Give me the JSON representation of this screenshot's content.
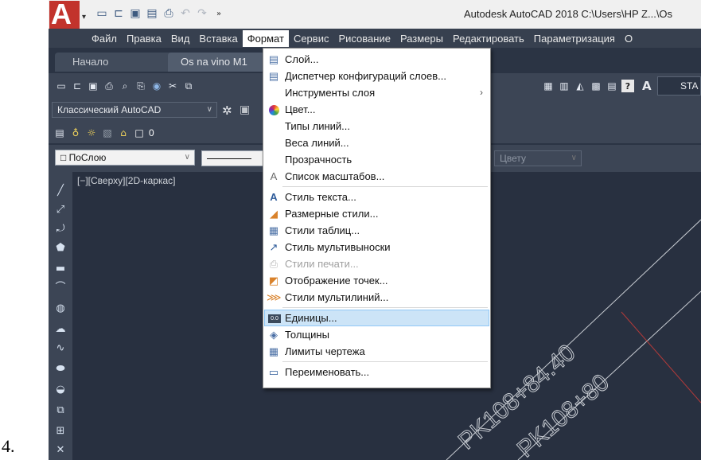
{
  "outer_label": "4.",
  "colors": {
    "app_background": "#2b3444",
    "menubar": "#37404f",
    "highlight": "#cce4f7",
    "logo_red": "#c2332c",
    "canvas_line_red": "#b03a3a"
  },
  "titlebar": {
    "logo_letter": "A",
    "app_title": "Autodesk AutoCAD 2018    C:\\Users\\HP Z...\\Os",
    "quick_access_icons": [
      "new-icon",
      "open-icon",
      "save-icon",
      "save-as-icon",
      "plot-icon",
      "undo-icon",
      "redo-icon",
      "more-icon"
    ]
  },
  "menubar": {
    "items": [
      {
        "label": "Файл"
      },
      {
        "label": "Правка"
      },
      {
        "label": "Вид"
      },
      {
        "label": "Вставка"
      },
      {
        "label": "Формат",
        "active": true
      },
      {
        "label": "Сервис"
      },
      {
        "label": "Рисование"
      },
      {
        "label": "Размеры"
      },
      {
        "label": "Редактировать"
      },
      {
        "label": "Параметризация"
      },
      {
        "label": "О"
      }
    ]
  },
  "tabs": {
    "start": "Начало",
    "drawing": "Os na vino M1"
  },
  "toolbar": {
    "workspace": "Классический AutoCAD",
    "style_button": "STA",
    "layer_value": "0",
    "bylayer": "ПоСлою",
    "bycolor": "Цвету"
  },
  "canvas": {
    "viewport_label": "[−][Сверху][2D-каркас]",
    "annotation_1": "PK108+84.40",
    "annotation_2": "PK108+80"
  },
  "format_menu": {
    "items": [
      {
        "label": "Слой...",
        "icon": "layer-icon"
      },
      {
        "label": "Диспетчер конфигураций слоев...",
        "icon": "layer-states-icon"
      },
      {
        "label": "Инструменты слоя",
        "submenu": true
      },
      {
        "label": "Цвет...",
        "icon": "color-wheel-icon"
      },
      {
        "label": "Типы линий..."
      },
      {
        "label": "Веса линий..."
      },
      {
        "label": "Прозрачность"
      },
      {
        "label": "Список масштабов...",
        "icon": "scale-list-icon"
      },
      {
        "label": "Стиль текста...",
        "icon": "text-style-icon"
      },
      {
        "label": "Размерные стили...",
        "icon": "dim-style-icon"
      },
      {
        "label": "Стили таблиц...",
        "icon": "table-style-icon"
      },
      {
        "label": "Стиль мультивыноски",
        "icon": "mleader-style-icon"
      },
      {
        "label": "Стили печати...",
        "icon": "plot-style-icon",
        "disabled": true
      },
      {
        "label": "Отображение точек...",
        "icon": "point-style-icon"
      },
      {
        "label": "Стили мультилиний...",
        "icon": "mline-style-icon"
      },
      {
        "label": "Единицы...",
        "icon": "units-icon",
        "highlighted": true
      },
      {
        "label": "Толщины",
        "icon": "thickness-icon"
      },
      {
        "label": "Лимиты чертежа",
        "icon": "limits-icon"
      },
      {
        "label": "Переименовать...",
        "icon": "rename-icon"
      }
    ]
  }
}
